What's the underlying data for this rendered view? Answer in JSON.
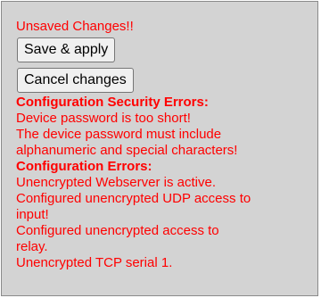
{
  "status": {
    "unsaved_text": "Unsaved Changes!!"
  },
  "buttons": {
    "save_label": "Save & apply",
    "cancel_label": "Cancel changes"
  },
  "security_errors": {
    "heading": "Configuration Security Errors:",
    "lines": [
      "Device password is too short!",
      "The device password must include",
      "alphanumeric and special characters!"
    ]
  },
  "config_errors": {
    "heading": "Configuration Errors:",
    "lines": [
      "Unencrypted Webserver is active.",
      "Configured unencrypted UDP access to",
      "input!",
      "Configured unencrypted access to",
      "relay.",
      "Unencrypted TCP serial 1."
    ]
  },
  "colors": {
    "error_text": "#ff0000",
    "panel_background": "#d3d3d3",
    "button_background": "#f0f0f0"
  }
}
